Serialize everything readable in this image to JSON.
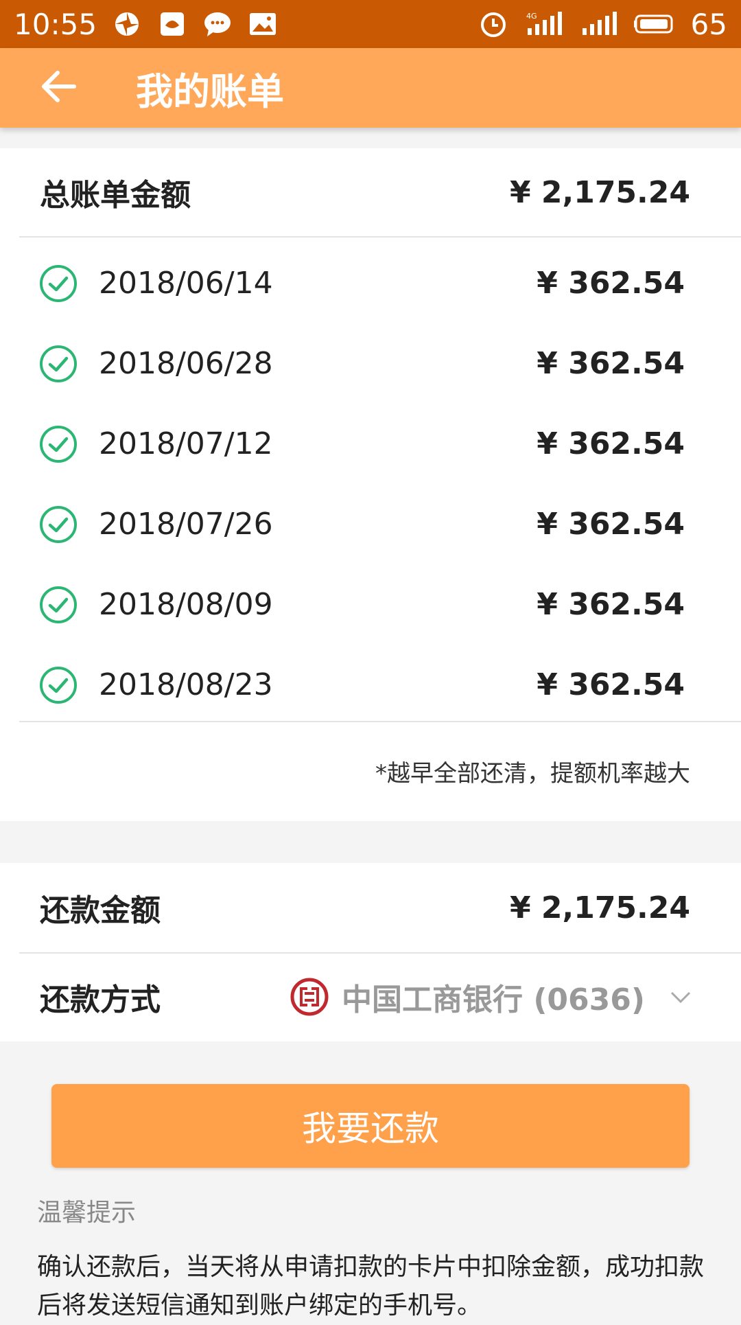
{
  "status_bar": {
    "time": "10:55",
    "battery": "65",
    "icons": [
      "pinwheel-icon",
      "app-icon",
      "chat-icon",
      "image-icon",
      "alarm-icon",
      "signal-4g-icon",
      "signal-icon",
      "battery-icon"
    ]
  },
  "app_bar": {
    "title": "我的账单",
    "back_icon": "arrow-left-icon"
  },
  "bill": {
    "total_label": "总账单金额",
    "total_amount": "¥ 2,175.24",
    "items": [
      {
        "date": "2018/06/14",
        "amount": "¥ 362.54",
        "status_icon": "check-circle-icon"
      },
      {
        "date": "2018/06/28",
        "amount": "¥ 362.54",
        "status_icon": "check-circle-icon"
      },
      {
        "date": "2018/07/12",
        "amount": "¥ 362.54",
        "status_icon": "check-circle-icon"
      },
      {
        "date": "2018/07/26",
        "amount": "¥ 362.54",
        "status_icon": "check-circle-icon"
      },
      {
        "date": "2018/08/09",
        "amount": "¥ 362.54",
        "status_icon": "check-circle-icon"
      },
      {
        "date": "2018/08/23",
        "amount": "¥ 362.54",
        "status_icon": "check-circle-icon"
      }
    ],
    "tip": "*越早全部还清，提额机率越大"
  },
  "repayment": {
    "amount_label": "还款金额",
    "amount": "¥ 2,175.24",
    "method_label": "还款方式",
    "method_value": "中国工商银行 (0636)"
  },
  "actions": {
    "repay_button": "我要还款"
  },
  "notice": {
    "title": "温馨提示",
    "text": "确认还款后，当天将从申请扣款的卡片中扣除金额，成功扣款后将发送短信通知到账户绑定的手机号。"
  },
  "colors": {
    "status_bar": "#c95a03",
    "app_bar": "#ffa85a",
    "button": "#ffa04a",
    "check_green": "#2bb673",
    "bank_red": "#c0292e"
  }
}
